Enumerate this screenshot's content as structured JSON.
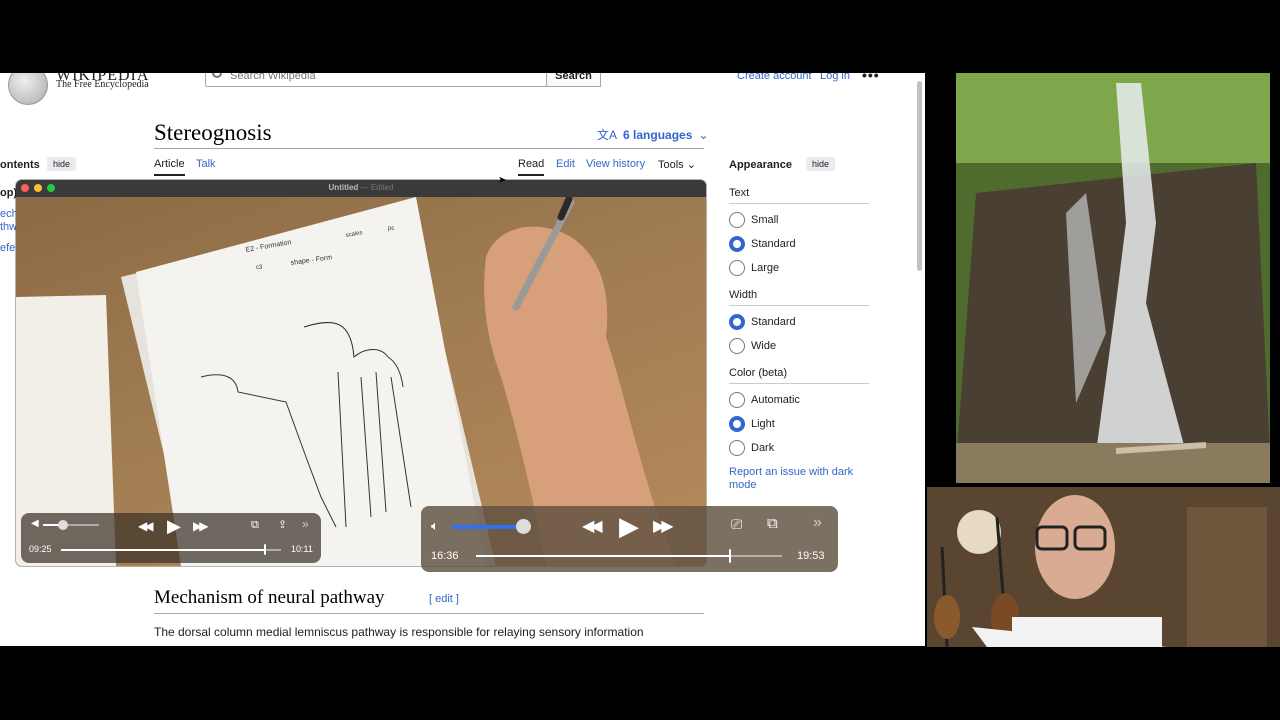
{
  "wiki": {
    "wordmark": "WIKIPEDIA",
    "tagline": "The Free Encyclopedia",
    "search_placeholder": "Search Wikipedia",
    "search_button": "Search",
    "create_account": "Create account",
    "login": "Log in",
    "more": "•••",
    "title": "Stereognosis",
    "languages": "6 languages",
    "contents_label": "ontents",
    "hide_label": "hide",
    "toc_fragments": [
      "op)",
      "ech",
      "thw",
      "efe"
    ],
    "tabs": {
      "article": "Article",
      "talk": "Talk",
      "read": "Read",
      "edit": "Edit",
      "history": "View history",
      "tools": "Tools"
    },
    "appearance": {
      "title": "Appearance",
      "hide": "hide",
      "text_label": "Text",
      "text_options": [
        "Small",
        "Standard",
        "Large"
      ],
      "text_selected": 1,
      "width_label": "Width",
      "width_options": [
        "Standard",
        "Wide"
      ],
      "width_selected": 0,
      "color_label": "Color (beta)",
      "color_options": [
        "Automatic",
        "Light",
        "Dark"
      ],
      "color_selected": 1,
      "report": "Report an issue with dark mode"
    },
    "section_heading": "Mechanism of neural pathway",
    "section_edit": "[ edit ]",
    "body_text": "The dorsal column medial lemniscus pathway is responsible for relaying sensory information"
  },
  "quicktime": {
    "title": "Untitled",
    "edited": "— Edited",
    "small_player": {
      "elapsed": "09:25",
      "total": "10:11",
      "progress": 0.925,
      "volume": 0.35
    },
    "big_player": {
      "elapsed": "16:36",
      "total": "19:53",
      "progress": 0.83,
      "volume": 0.95
    },
    "whiteboard_notes": [
      "E2 - Formation",
      "scales",
      "pc",
      "c3",
      "shape - Form"
    ]
  },
  "colors": {
    "link": "#3366cc",
    "radio_on": "#3366cc"
  }
}
